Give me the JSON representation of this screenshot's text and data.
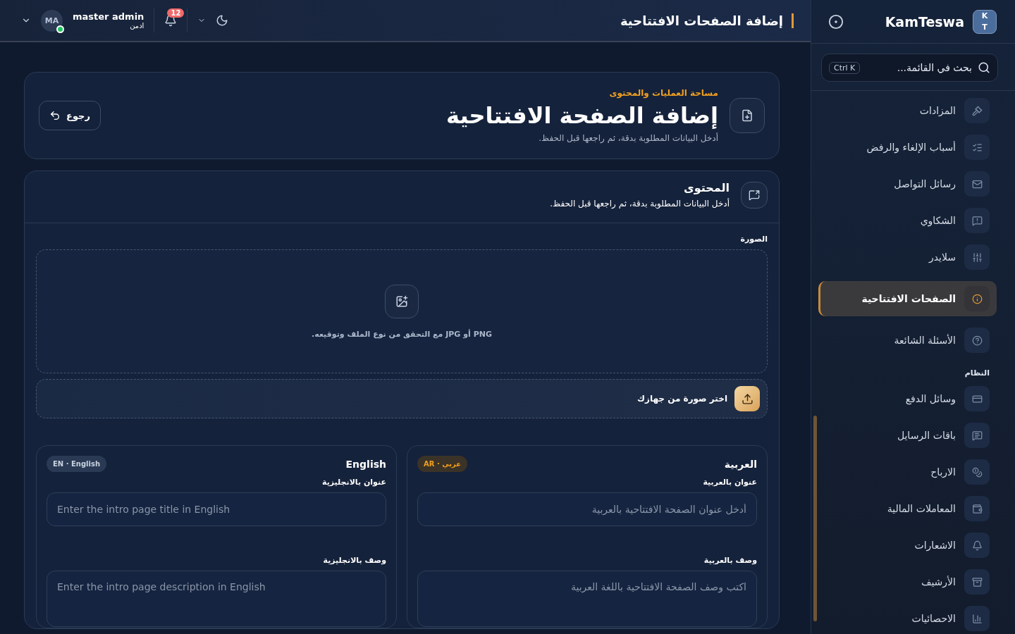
{
  "header": {
    "title": "إضافة الصفحات الافتتاحية",
    "notifications": "12",
    "user": {
      "name": "master admin",
      "role": "ادمن",
      "initials": "MA",
      "online": true
    }
  },
  "sidebar": {
    "logo": [
      "K",
      "T"
    ],
    "brand": "KamTeswa",
    "search": {
      "placeholder": "بحث في القائمة...",
      "shortcut": "Ctrl K"
    },
    "sections": [
      {
        "items": [
          {
            "label": "المزادات",
            "selected": false
          },
          {
            "label": "أسباب الإلغاء والرفض",
            "selected": false
          },
          {
            "label": "رسائل التواصل",
            "selected": false
          },
          {
            "label": "الشكاوي",
            "selected": false
          },
          {
            "label": "سلايدر",
            "selected": false
          },
          {
            "label": "الصفحات الافتتاحية",
            "selected": true
          },
          {
            "label": "الأسئلة الشائعة",
            "selected": false
          }
        ]
      },
      {
        "title": "النظام",
        "items": [
          {
            "label": "وسائل الدفع",
            "selected": false
          },
          {
            "label": "باقات الرسايل",
            "selected": false
          },
          {
            "label": "الارباح",
            "selected": false
          },
          {
            "label": "المعاملات المالية",
            "selected": false
          },
          {
            "label": "الاشعارات",
            "selected": false
          },
          {
            "label": "الأرشيف",
            "selected": false
          },
          {
            "label": "الاحصائيات",
            "selected": false
          }
        ]
      }
    ]
  },
  "hero": {
    "eyebrow": "مساحة العمليات والمحتوى",
    "title": "إضافة الصفحة الافتتاحية",
    "subtitle": "أدخل البيانات المطلوبة بدقة، ثم راجعها قبل الحفظ.",
    "back": "رجوع"
  },
  "content": {
    "title": "المحتوى",
    "subtitle": "أدخل البيانات المطلوبة بدقة، ثم راجعها قبل الحفظ.",
    "image_label": "الصورة",
    "drop_hint": "PNG أو JPG مع التحقق من نوع الملف وتوقيعه.",
    "upload": "اختر صورة من جهازك"
  },
  "languages": [
    {
      "kind": "ar",
      "title": "العربية",
      "badge": "AR · عربي",
      "fields": [
        {
          "label": "عنوان بالعربية",
          "placeholder": "أدخل عنوان الصفحة الافتتاحية بالعربية",
          "kind": "line"
        },
        {
          "label": "وصف بالعربية",
          "placeholder": "اكتب وصف الصفحة الافتتاحية باللغة العربية",
          "kind": "multi"
        }
      ]
    },
    {
      "kind": "en",
      "title": "English",
      "badge": "EN · English",
      "fields": [
        {
          "label": "عنوان بالانجليزية",
          "placeholder": "Enter the intro page title in English",
          "kind": "line"
        },
        {
          "label": "وصف بالانجليزية",
          "placeholder": "Enter the intro page description in English",
          "kind": "multi"
        }
      ]
    }
  ]
}
